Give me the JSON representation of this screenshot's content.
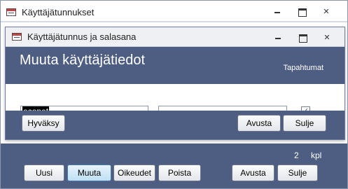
{
  "outer_window": {
    "title": "Käyttäjätunnukset",
    "record_count": "2",
    "record_unit": "kpl",
    "buttons": {
      "new": "Uusi",
      "edit": "Muuta",
      "rights": "Oikeudet",
      "delete": "Poista",
      "help": "Avusta",
      "close": "Sulje"
    }
  },
  "dialog": {
    "title": "Käyttäjätunnus ja salasana",
    "heading": "Muuta käyttäjätiedot",
    "events_label": "Tapahtumat",
    "username_value": "econet",
    "password_value": "",
    "events_checked": "✓",
    "buttons": {
      "accept": "Hyväksy",
      "help": "Avusta",
      "close": "Sulje"
    }
  },
  "colors": {
    "band": "#4e5d82",
    "active_button": "#bfe0f4"
  }
}
